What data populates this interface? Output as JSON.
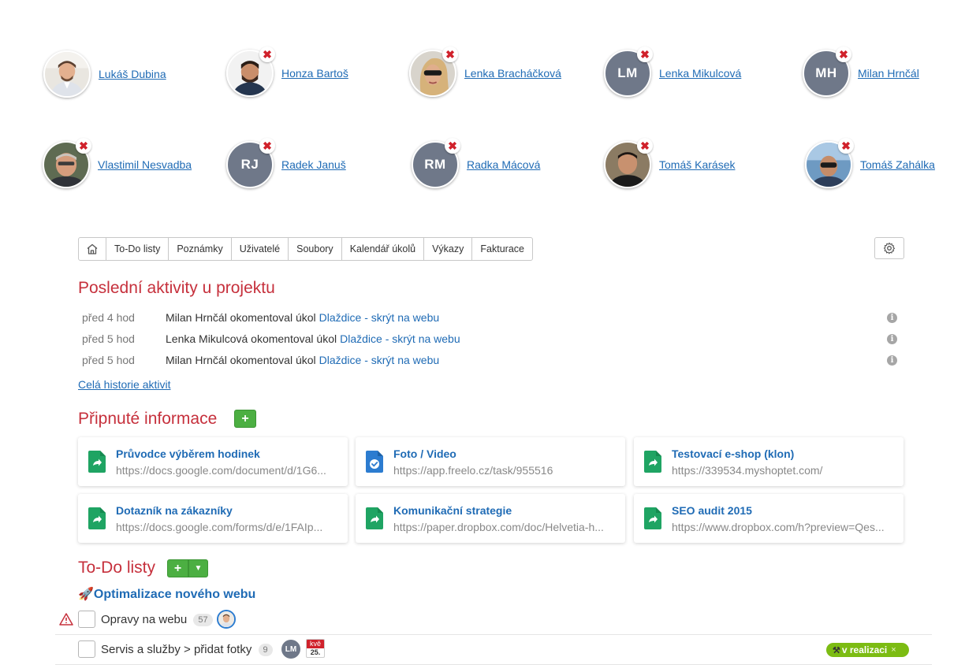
{
  "members": [
    {
      "name": "Lukáš Dubina",
      "avatar": "photo",
      "removable": false
    },
    {
      "name": "Honza Bartoš",
      "avatar": "photo",
      "removable": true
    },
    {
      "name": "Lenka Bracháčková",
      "avatar": "photo",
      "removable": true
    },
    {
      "name": "Lenka Mikulcová",
      "initials": "LM",
      "removable": true
    },
    {
      "name": "Milan Hrnčál",
      "initials": "MH",
      "removable": true
    },
    {
      "name": "Vlastimil Nesvadba",
      "avatar": "photo",
      "removable": true
    },
    {
      "name": "Radek Januš",
      "initials": "RJ",
      "removable": true
    },
    {
      "name": "Radka Mácová",
      "initials": "RM",
      "removable": true
    },
    {
      "name": "Tomáš Karásek",
      "avatar": "photo",
      "removable": true
    },
    {
      "name": "Tomáš Zahálka",
      "avatar": "photo",
      "removable": true
    }
  ],
  "remove_glyph": "✖",
  "tabs": [
    "To-Do listy",
    "Poznámky",
    "Uživatelé",
    "Soubory",
    "Kalendář úkolů",
    "Výkazy",
    "Fakturace"
  ],
  "icons": {
    "home": "home-icon",
    "settings": "gear-icon",
    "info": "info-icon",
    "warning": "warning-icon",
    "rocket": "rocket-icon"
  },
  "activity": {
    "title": "Poslední aktivity u projektu",
    "items": [
      {
        "time": "před 4 hod",
        "text": "Milan Hrnčál okomentoval úkol",
        "link": "Dlaždice - skrýt na webu"
      },
      {
        "time": "před 5 hod",
        "text": "Lenka Mikulcová okomentoval úkol",
        "link": "Dlaždice - skrýt na webu"
      },
      {
        "time": "před 5 hod",
        "text": "Milan Hrnčál okomentoval úkol",
        "link": "Dlaždice - skrýt na webu"
      }
    ],
    "history_link": "Celá historie aktivit"
  },
  "pinned": {
    "title": "Připnuté informace",
    "add_label": "+",
    "cards": [
      {
        "title": "Průvodce výběrem hodinek",
        "url": "https://docs.google.com/document/d/1G6...",
        "icon": "shared-doc",
        "color": "#1fa463"
      },
      {
        "title": "Foto / Video",
        "url": "https://app.freelo.cz/task/955516",
        "icon": "freelo-task",
        "color": "#2c7cd0"
      },
      {
        "title": "Testovací e-shop (klon)",
        "url": "https://339534.myshoptet.com/",
        "icon": "shared-doc",
        "color": "#1fa463"
      },
      {
        "title": "Dotazník na zákazníky",
        "url": "https://docs.google.com/forms/d/e/1FAIp...",
        "icon": "shared-doc",
        "color": "#1fa463"
      },
      {
        "title": "Komunikační strategie",
        "url": "https://paper.dropbox.com/doc/Helvetia-h...",
        "icon": "shared-doc",
        "color": "#1fa463"
      },
      {
        "title": "SEO audit 2015",
        "url": "https://www.dropbox.com/h?preview=Qes...",
        "icon": "shared-doc",
        "color": "#1fa463"
      }
    ]
  },
  "todo": {
    "title": "To-Do listy",
    "add_label": "+",
    "caret": "▼",
    "list_emoji": "🚀",
    "list_title": "Optimalizace nového webu",
    "tasks": [
      {
        "name": "Opravy na webu",
        "count": "57",
        "warning": true,
        "assignee": "photo"
      },
      {
        "name": "Servis a služby > přidat fotky",
        "count": "9",
        "assignee_initials": "LM",
        "due_month": "kvě",
        "due_day": "25.",
        "status": "v realizaci",
        "status_close": "×"
      }
    ]
  },
  "colors": {
    "accent_red": "#c6303c",
    "link_blue": "#1f6bb5",
    "green": "#4caf42",
    "status_green": "#7cbc13",
    "avatar_gray": "#6f7889"
  }
}
